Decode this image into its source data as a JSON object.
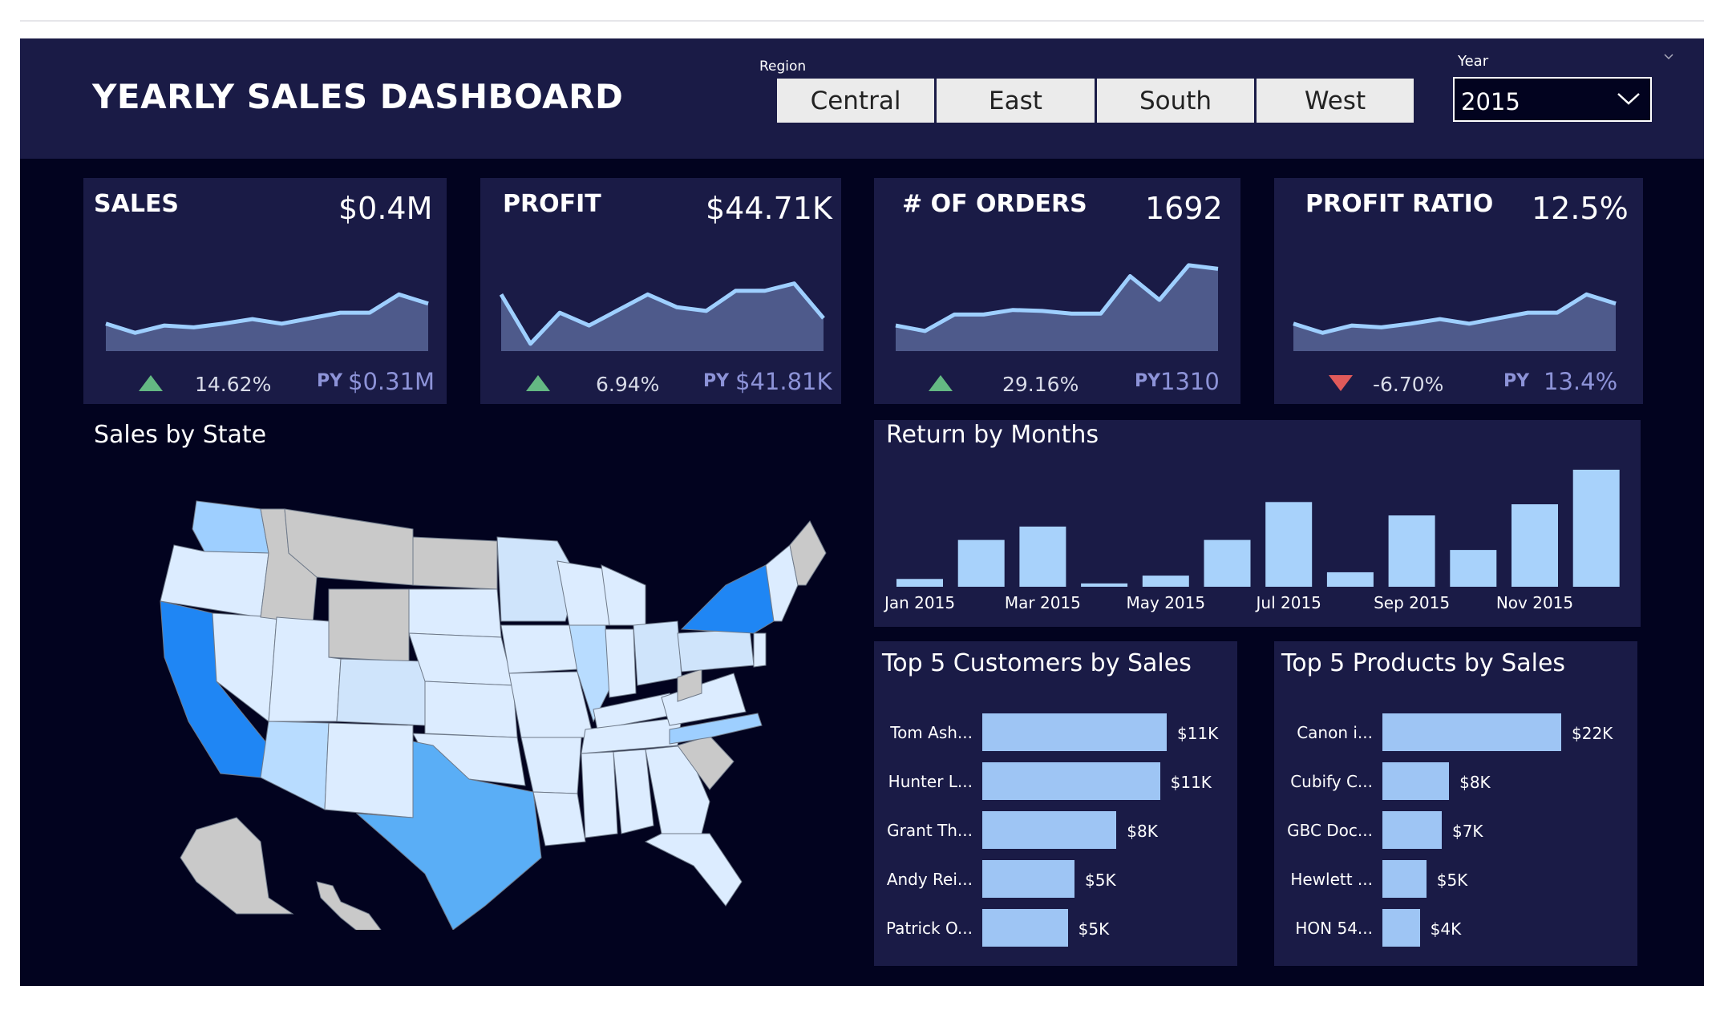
{
  "header": {
    "title": "YEARLY SALES DASHBOARD",
    "region_label": "Region",
    "regions": [
      "Central",
      "East",
      "South",
      "West"
    ],
    "year_label": "Year",
    "year_value": "2015"
  },
  "kpis": [
    {
      "title": "SALES",
      "value": "$0.4M",
      "delta": "14.62%",
      "trend": "up",
      "py_label": "PY",
      "py_value": "$0.31M"
    },
    {
      "title": "PROFIT",
      "value": "$44.71K",
      "delta": "6.94%",
      "trend": "up",
      "py_label": "PY",
      "py_value": "$41.81K"
    },
    {
      "title": "# OF ORDERS",
      "value": "1692",
      "delta": "29.16%",
      "trend": "up",
      "py_label": "PY",
      "py_value": "1310"
    },
    {
      "title": "PROFIT RATIO",
      "value": "12.5%",
      "delta": "-6.70%",
      "trend": "down",
      "py_label": "PY",
      "py_value": "13.4%"
    }
  ],
  "map": {
    "title": "Sales by State"
  },
  "returns": {
    "title": "Return by Months"
  },
  "customers": {
    "title": "Top 5 Customers by Sales"
  },
  "products": {
    "title": "Top 5 Products by Sales"
  },
  "colors": {
    "accent": "#9ecfff",
    "bar_fill": "#9ec5f4",
    "month_bar": "#a8d2fb",
    "up_arrow": "#64b883",
    "down_arrow": "#e05a5a",
    "card_bg": "#1a1b46",
    "page_bg": "#02031f"
  },
  "chart_data": [
    {
      "type": "area",
      "name": "sales_sparkline",
      "values": [
        30,
        20,
        28,
        26,
        30,
        35,
        30,
        36,
        42,
        42,
        62,
        52
      ]
    },
    {
      "type": "area",
      "name": "profit_sparkline",
      "values": [
        62,
        8,
        42,
        28,
        45,
        62,
        48,
        44,
        66,
        66,
        74,
        36
      ]
    },
    {
      "type": "area",
      "name": "orders_sparkline",
      "values": [
        28,
        22,
        40,
        40,
        45,
        44,
        41,
        41,
        82,
        56,
        94,
        90
      ]
    },
    {
      "type": "area",
      "name": "profit_ratio_sparkline",
      "values": [
        30,
        20,
        28,
        26,
        30,
        35,
        30,
        36,
        42,
        42,
        62,
        52
      ]
    },
    {
      "type": "bar",
      "name": "return_by_months",
      "title": "Return by Months",
      "categories": [
        "Jan 2015",
        "Feb 2015",
        "Mar 2015",
        "Apr 2015",
        "May 2015",
        "Jun 2015",
        "Jul 2015",
        "Aug 2015",
        "Sep 2015",
        "Oct 2015",
        "Nov 2015",
        "Dec 2015"
      ],
      "tick_labels": [
        "Jan 2015",
        "Mar 2015",
        "May 2015",
        "Jul 2015",
        "Sep 2015",
        "Nov 2015"
      ],
      "values": [
        7,
        42,
        54,
        3,
        10,
        42,
        76,
        13,
        64,
        33,
        74,
        105
      ]
    },
    {
      "type": "bar",
      "name": "top_customers",
      "title": "Top 5 Customers by Sales",
      "categories": [
        "Tom Ash...",
        "Hunter L...",
        "Grant Th...",
        "Andy Rei...",
        "Patrick O..."
      ],
      "values": [
        11,
        10.6,
        8,
        5.5,
        5.1
      ],
      "value_labels": [
        "$11K",
        "$11K",
        "$8K",
        "$5K",
        "$5K"
      ]
    },
    {
      "type": "bar",
      "name": "top_products",
      "title": "Top 5 Products by Sales",
      "categories": [
        "Canon i...",
        "Cubify C...",
        "GBC Doc...",
        "Hewlett ...",
        "HON 54..."
      ],
      "values": [
        22,
        8.2,
        7.3,
        5.4,
        4.6
      ],
      "value_labels": [
        "$22K",
        "$8K",
        "$7K",
        "$5K",
        "$4K"
      ]
    }
  ]
}
